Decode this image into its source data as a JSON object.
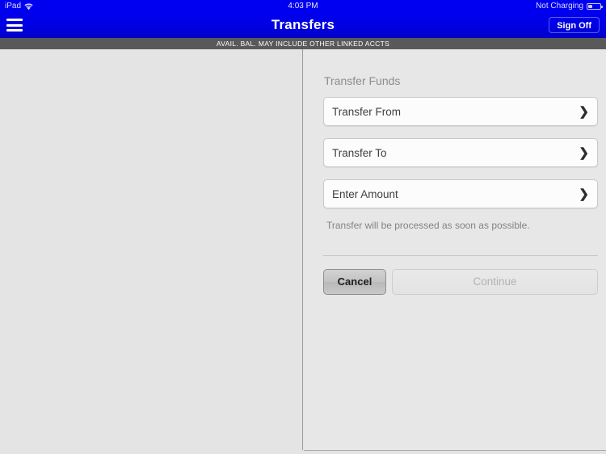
{
  "status_bar": {
    "device_label": "iPad",
    "wifi_icon": "wifi-icon",
    "time": "4:03 PM",
    "battery_status": "Not Charging",
    "battery_icon": "battery-icon"
  },
  "nav_bar": {
    "menu_icon": "hamburger-menu-icon",
    "title": "Transfers",
    "sign_off_label": "Sign Off",
    "background_color": "#0000e2"
  },
  "notice_bar": {
    "text": "AVAIL. BAL. MAY INCLUDE OTHER LINKED ACCTS",
    "background_color": "#595959"
  },
  "transfer_form": {
    "section_title": "Transfer Funds",
    "fields": [
      {
        "label": "Transfer From",
        "value": "",
        "chevron": "❯"
      },
      {
        "label": "Transfer To",
        "value": "",
        "chevron": "❯"
      },
      {
        "label": "Enter Amount",
        "value": "",
        "chevron": "❯"
      }
    ],
    "helper_text": "Transfer will be processed as soon as possible.",
    "cancel_label": "Cancel",
    "continue_label": "Continue"
  }
}
